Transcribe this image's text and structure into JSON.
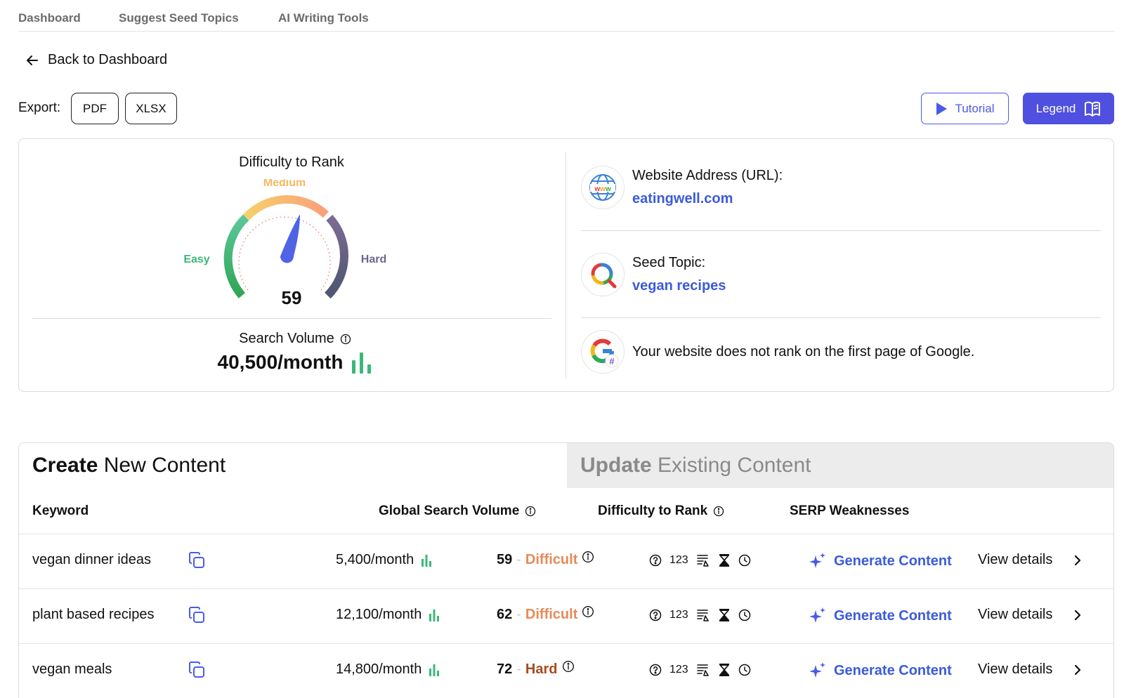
{
  "nav": {
    "dashboard": "Dashboard",
    "suggest": "Suggest Seed Topics",
    "ai_tools": "AI Writing Tools"
  },
  "back_label": "Back to Dashboard",
  "export": {
    "label": "Export:",
    "pdf": "PDF",
    "xlsx": "XLSX"
  },
  "tutorial_label": "Tutorial",
  "legend_label": "Legend",
  "difficulty": {
    "title": "Difficulty to Rank",
    "easy": "Easy",
    "medium": "Medium",
    "hard": "Hard",
    "value": "59",
    "colors": {
      "easy": "#3cb878",
      "medium": "#f5b862",
      "hard": "#6e6590",
      "needle": "#4f63e6"
    }
  },
  "search_volume": {
    "title": "Search Volume",
    "value": "40,500/month"
  },
  "website": {
    "label": "Website Address (URL):",
    "value": "eatingwell.com"
  },
  "seed": {
    "label": "Seed Topic:",
    "value": "vegan recipes"
  },
  "google_rank": {
    "message": "Your website does not rank on the first page of Google."
  },
  "tabs": {
    "create_bold": "Create",
    "create_rest": " New Content",
    "update_bold": "Update",
    "update_rest": " Existing Content"
  },
  "columns": {
    "keyword": "Keyword",
    "volume": "Global Search Volume",
    "difficulty": "Difficulty to Rank",
    "serp": "SERP Weaknesses"
  },
  "rows": [
    {
      "keyword": "vegan dinner ideas",
      "volume": "5,400/month",
      "score": "59",
      "level": "Difficult",
      "serp_num": "123",
      "generate": "Generate Content",
      "view": "View details"
    },
    {
      "keyword": "plant based recipes",
      "volume": "12,100/month",
      "score": "62",
      "level": "Difficult",
      "serp_num": "123",
      "generate": "Generate Content",
      "view": "View details"
    },
    {
      "keyword": "vegan meals",
      "volume": "14,800/month",
      "score": "72",
      "level": "Hard",
      "serp_num": "123",
      "generate": "Generate Content",
      "view": "View details"
    }
  ],
  "level_colors": {
    "Difficult": "#e58a58",
    "Hard": "#a84a1f"
  },
  "accent": "#4f4fe0"
}
